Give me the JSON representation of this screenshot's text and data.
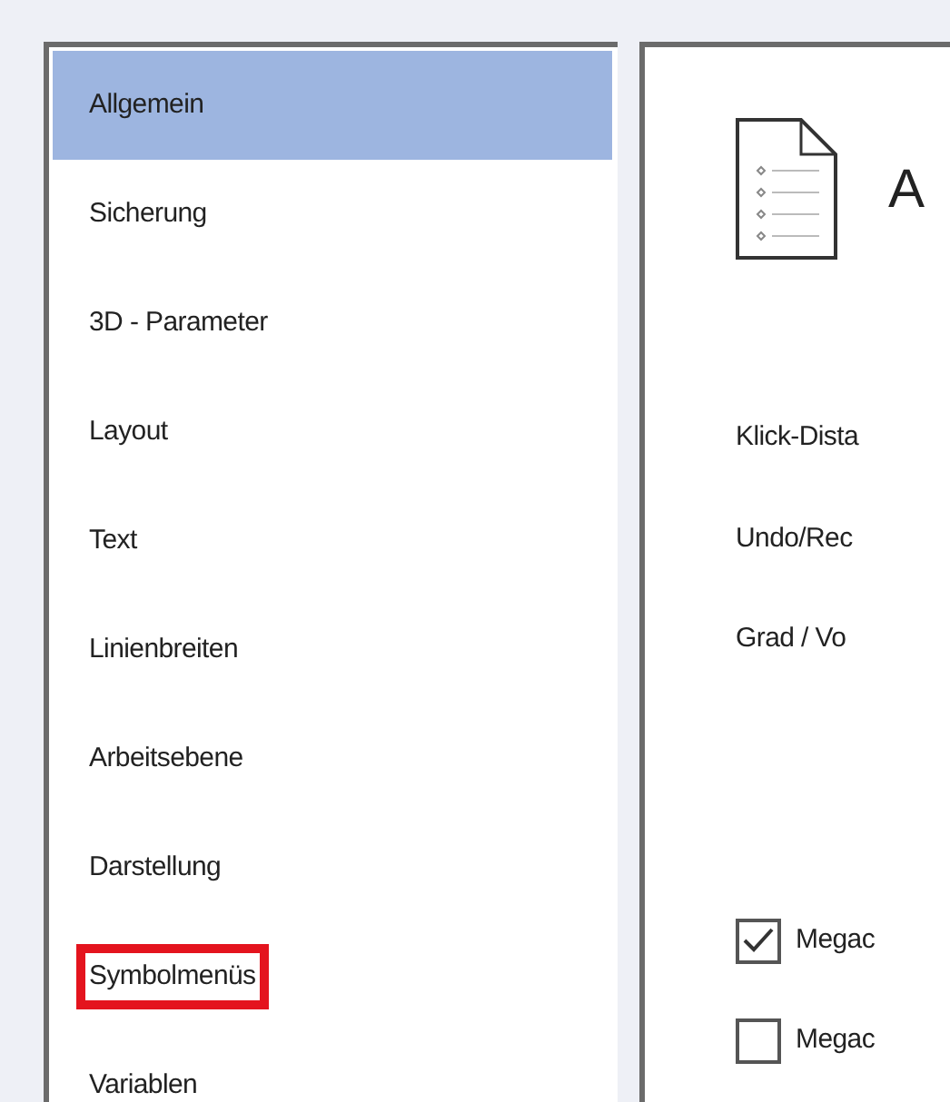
{
  "sidebar": {
    "items": [
      {
        "label": "Allgemein",
        "selected": true,
        "highlighted": false
      },
      {
        "label": "Sicherung",
        "selected": false,
        "highlighted": false
      },
      {
        "label": "3D - Parameter",
        "selected": false,
        "highlighted": false
      },
      {
        "label": "Layout",
        "selected": false,
        "highlighted": false
      },
      {
        "label": "Text",
        "selected": false,
        "highlighted": false
      },
      {
        "label": "Linienbreiten",
        "selected": false,
        "highlighted": false
      },
      {
        "label": "Arbeitsebene",
        "selected": false,
        "highlighted": false
      },
      {
        "label": "Darstellung",
        "selected": false,
        "highlighted": false
      },
      {
        "label": "Symbolmenüs",
        "selected": false,
        "highlighted": true
      },
      {
        "label": "Variablen",
        "selected": false,
        "highlighted": false
      }
    ]
  },
  "panel": {
    "title": "A",
    "labels": [
      "Klick-Dista",
      "Undo/Rec",
      "Grad / Vo"
    ],
    "checkboxes": [
      {
        "label": "Megac",
        "checked": true
      },
      {
        "label": "Megac",
        "checked": false
      }
    ]
  }
}
